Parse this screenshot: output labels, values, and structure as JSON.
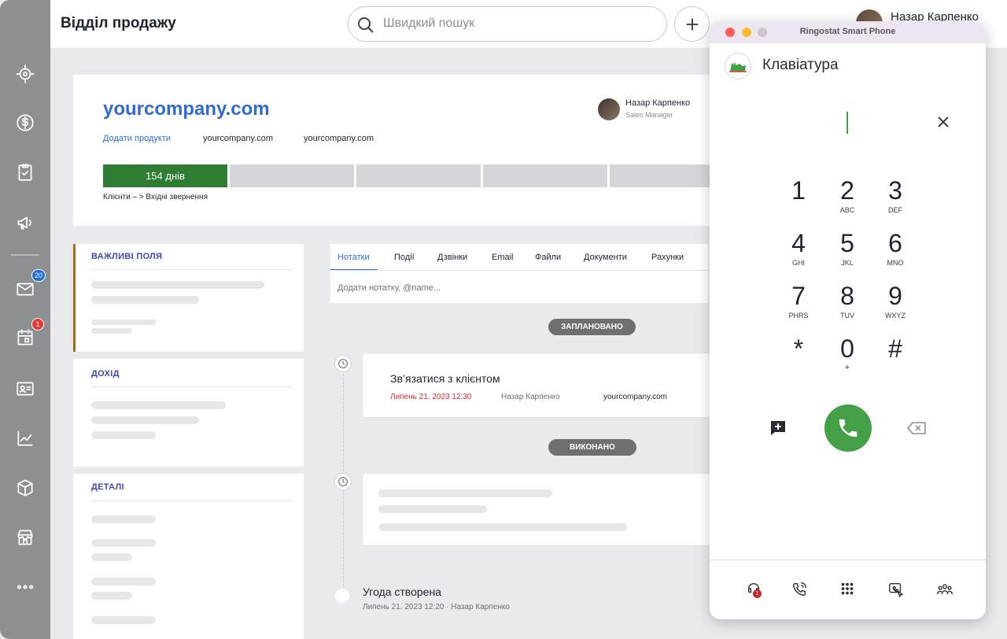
{
  "header": {
    "title": "Відділ продажу",
    "search_placeholder": "Швидкий пошук",
    "user_name": "Назар Карпенко"
  },
  "rail": {
    "mail_badge": "20",
    "calendar_badge": "1"
  },
  "deal": {
    "title": "yourcompany.com",
    "add_products": "Додати продукти",
    "field_1": "yourcompany.com",
    "field_2": "yourcompany.com",
    "owner_name": "Назар Карпенко",
    "owner_role": "Sales Manager",
    "stage_active": "154 днів",
    "path": "Клієнти – > Вхідні звернення"
  },
  "panels": {
    "important": "ВАЖЛИВІ ПОЛЯ",
    "income": "ДОХІД",
    "details": "ДЕТАЛІ"
  },
  "tabs": [
    "Нотатки",
    "Події",
    "Дзвінки",
    "Email",
    "Файли",
    "Документи",
    "Рахунки"
  ],
  "note_placeholder": "Додати нотатку, @name...",
  "timeline": {
    "planned_label": "ЗАПЛАНОВАНО",
    "done_label": "ВИКОНАНО",
    "task_title": "Зв’язатися з клієнтом",
    "task_date": "Липень 21. 2023 12:30",
    "task_user": "Назар Карпенко",
    "task_company": "yourcompany.com",
    "created_title": "Угода створена",
    "created_meta": "Липень 21. 2023 12:20 · Назар Карпенко"
  },
  "phone": {
    "window_title": "Ringostat Smart Phone",
    "heading": "Клавіатура",
    "keys": [
      {
        "d": "1",
        "l": ""
      },
      {
        "d": "2",
        "l": "ABC"
      },
      {
        "d": "3",
        "l": "DEF"
      },
      {
        "d": "4",
        "l": "GHI"
      },
      {
        "d": "5",
        "l": "JKL"
      },
      {
        "d": "6",
        "l": "MNO"
      },
      {
        "d": "7",
        "l": "PHRS"
      },
      {
        "d": "8",
        "l": "TUV"
      },
      {
        "d": "9",
        "l": "WXYZ"
      },
      {
        "d": "*",
        "l": ""
      },
      {
        "d": "0",
        "l": "+"
      },
      {
        "d": "#",
        "l": ""
      }
    ],
    "footer_badge": "1",
    "colors": {
      "call": "#43a047",
      "close": "#ff5f57",
      "minimize": "#febc2e",
      "maximize": "#c8c8cc"
    }
  }
}
